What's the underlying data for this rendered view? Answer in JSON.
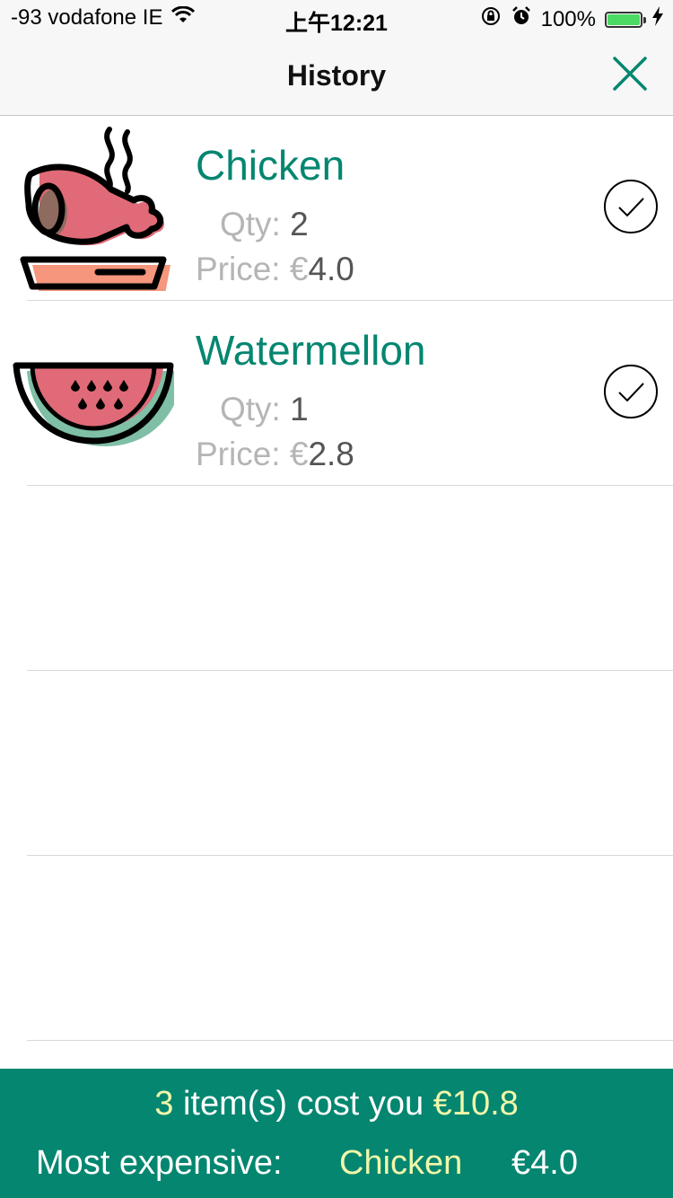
{
  "status_bar": {
    "carrier": "-93 vodafone IE",
    "time": "上午12:21",
    "battery_percent": "100%",
    "battery_level": 1.0
  },
  "nav": {
    "title": "History"
  },
  "labels": {
    "qty": "Qty:",
    "price": "Price:",
    "currency": "€"
  },
  "items": [
    {
      "name": "Chicken",
      "qty": "2",
      "price": "4.0",
      "icon": "chicken-leg-icon",
      "checked": true
    },
    {
      "name": "Watermellon",
      "qty": "1",
      "price": "2.8",
      "icon": "watermelon-icon",
      "checked": true
    }
  ],
  "footer": {
    "item_count": "3",
    "cost_text": "item(s) cost you",
    "total": "€10.8",
    "most_expensive_label": "Most expensive:",
    "most_expensive_name": "Chicken",
    "most_expensive_price": "€4.0"
  },
  "colors": {
    "accent": "#048670",
    "highlight": "#f1f7a9",
    "muted": "#b5b5b5"
  }
}
